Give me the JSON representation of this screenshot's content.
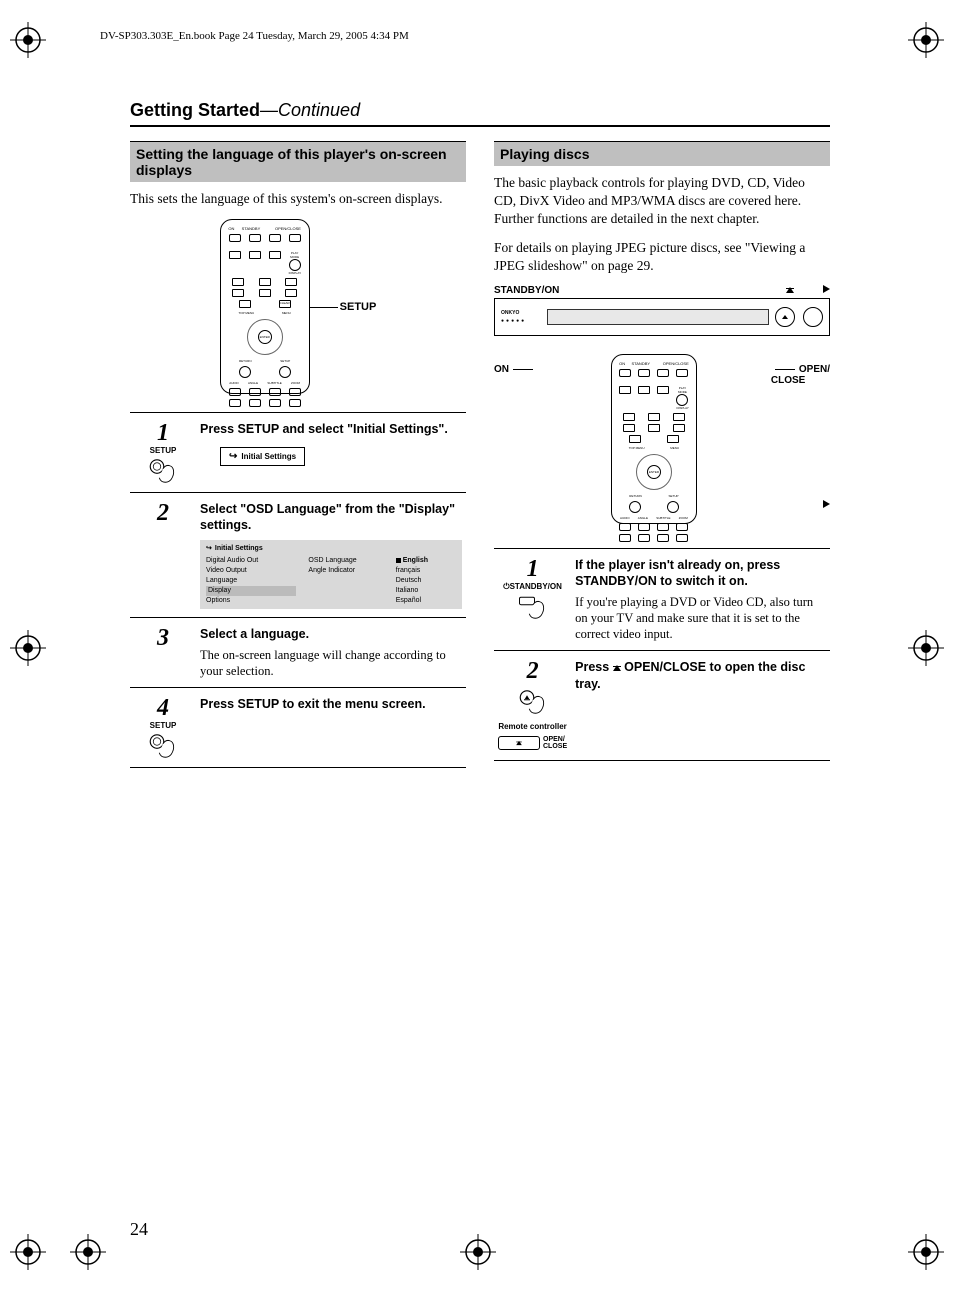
{
  "meta": {
    "header_line": "DV-SP303.303E_En.book  Page 24  Tuesday, March 29, 2005  4:34 PM"
  },
  "page_title_main": "Getting Started",
  "page_title_cont": "—Continued",
  "left": {
    "section_header": "Setting the language of this player's on-screen displays",
    "intro": "This sets the language of this system's on-screen displays.",
    "remote_callout": "SETUP",
    "remote_labels": {
      "row1": [
        "ON",
        "STANDBY",
        "",
        "OPEN/CLOSE"
      ],
      "play_mode": "PLAY MODE",
      "display": "DISPLAY",
      "clear": "CLEAR",
      "top_menu": "TOP MENU",
      "menu": "MENU",
      "enter": "ENTER",
      "return": "RETURN",
      "setup": "SETUP",
      "bottom": [
        "AUDIO",
        "ANGLE",
        "SUBTITLE",
        "ZOOM"
      ]
    },
    "steps": [
      {
        "num": "1",
        "icon_label": "SETUP",
        "title": "Press SETUP and select \"Initial Settings\".",
        "osd_initial": "Initial Settings"
      },
      {
        "num": "2",
        "title": "Select \"OSD Language\" from the \"Display\" settings.",
        "panel": {
          "header": "Initial Settings",
          "c1": [
            "Digital Audio Out",
            "Video Output",
            "Language",
            "Display",
            "Options"
          ],
          "c1_selected_index": 3,
          "c2": [
            "OSD Language",
            "Angle Indicator"
          ],
          "c3": [
            "English",
            "français",
            "Deutsch",
            "Italiano",
            "Español"
          ],
          "c3_selected_index": 0
        }
      },
      {
        "num": "3",
        "title": "Select a language.",
        "body": "The on-screen language will change according to your selection."
      },
      {
        "num": "4",
        "icon_label": "SETUP",
        "title": "Press SETUP to exit the menu screen."
      }
    ]
  },
  "right": {
    "section_header": "Playing discs",
    "intro1": "The basic playback controls for playing DVD, CD, Video CD, DivX Video and MP3/WMA discs are covered here. Further functions are detailed in the next chapter.",
    "intro2": "For details on playing JPEG picture discs, see \"Viewing a JPEG slideshow\" on page 29.",
    "player_label": "STANDBY/ON",
    "callout_on": "ON",
    "callout_open": "OPEN/\nCLOSE",
    "steps": [
      {
        "num": "1",
        "icon_label": "STANDBY/ON",
        "title": "If the player isn't already on, press STANDBY/ON to switch it on.",
        "body": "If you're playing a DVD or Video CD, also turn on your TV and make sure that it is set to the correct video input."
      },
      {
        "num": "2",
        "title_pre": "Press ",
        "title_post": " OPEN/CLOSE to open the disc tray.",
        "remote_label": "Remote controller",
        "open_close": "OPEN/\nCLOSE"
      }
    ]
  },
  "page_number": "24"
}
